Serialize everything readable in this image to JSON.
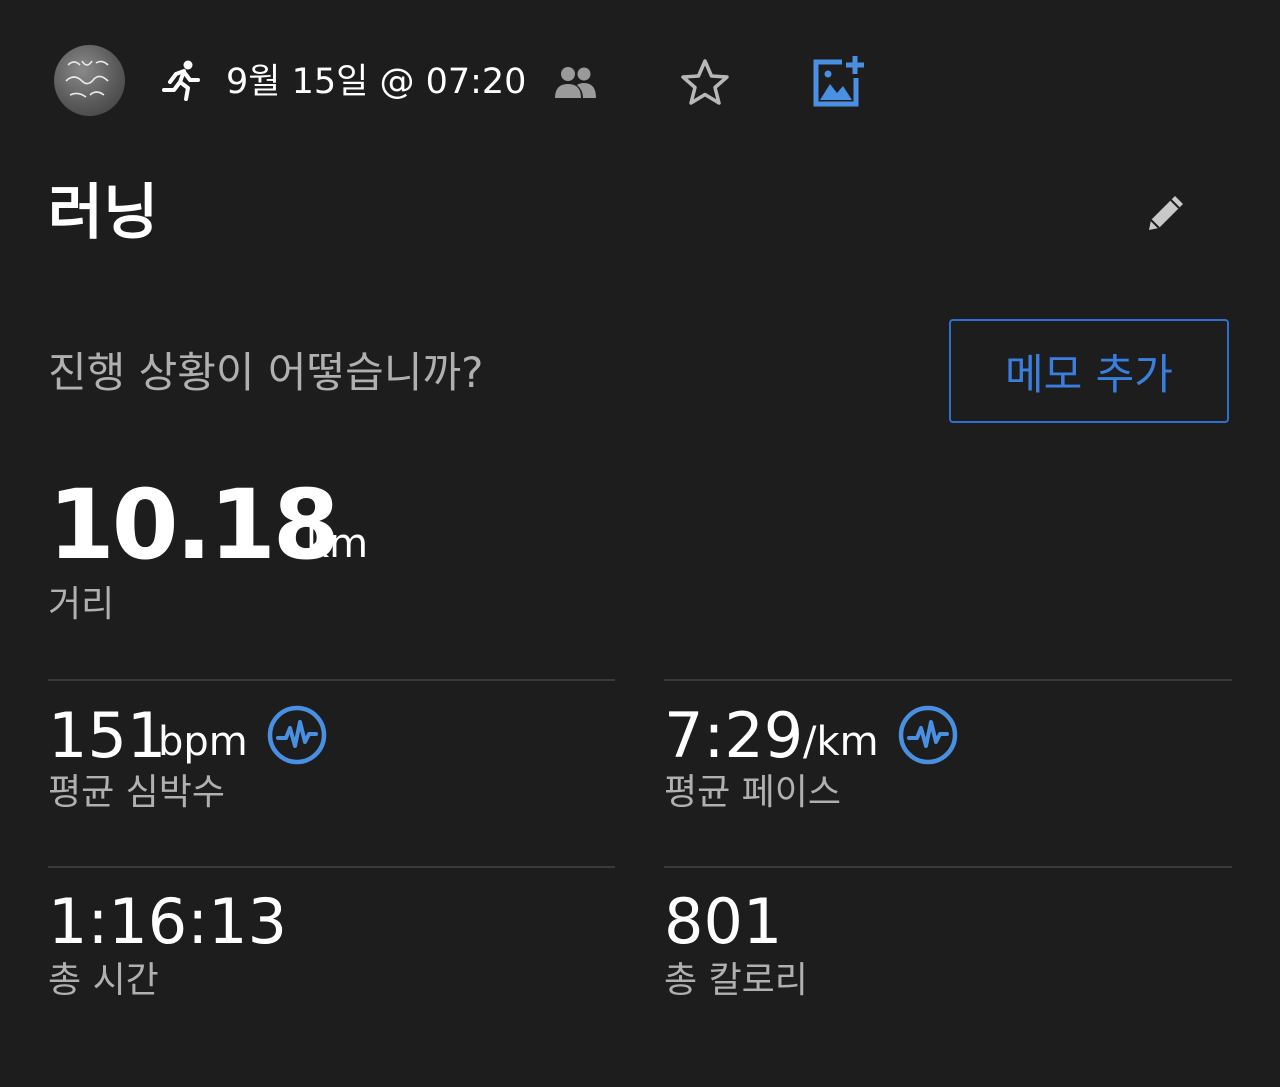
{
  "header": {
    "datetime": "9월 15일 @ 07:20",
    "icons": {
      "avatar": "profile-avatar",
      "activity": "running-icon",
      "group": "people-icon",
      "favorite": "star-outline-icon",
      "add_photo": "add-photo-icon"
    },
    "accent_color": "#4a90e2"
  },
  "activity": {
    "title": "러닝",
    "edit_icon": "pencil-icon"
  },
  "note": {
    "prompt": "진행 상황이 어떻습니까?",
    "button_label": "메모 추가"
  },
  "distance": {
    "value": "10.18",
    "unit": "km",
    "label": "거리"
  },
  "stats": {
    "heart_rate": {
      "value": "151",
      "unit": "bpm",
      "label": "평균 심박수",
      "icon": "heart-rate-wave-icon"
    },
    "pace": {
      "value": "7:29",
      "unit": "/km",
      "label": "평균 페이스",
      "icon": "heart-rate-wave-icon"
    },
    "time": {
      "value": "1:16:13",
      "label": "총 시간"
    },
    "calories": {
      "value": "801",
      "label": "총 칼로리"
    }
  }
}
